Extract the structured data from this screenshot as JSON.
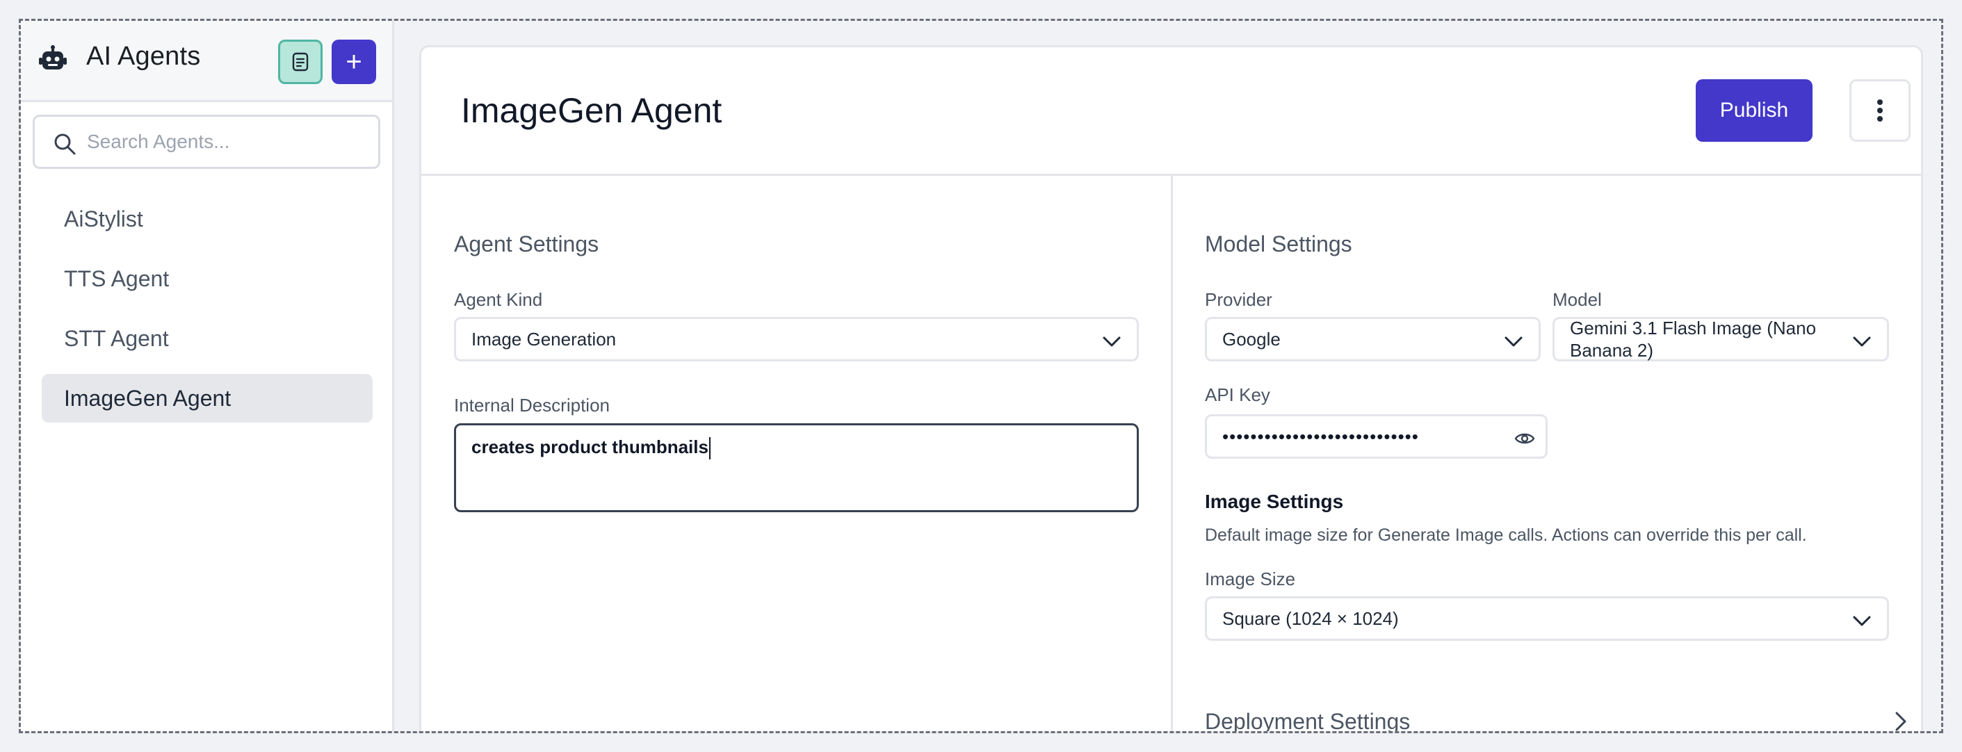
{
  "sidebar": {
    "title": "AI Agents",
    "search_placeholder": "Search Agents...",
    "agents": [
      "AiStylist",
      "TTS Agent",
      "STT Agent",
      "ImageGen Agent"
    ],
    "active_agent": "ImageGen Agent",
    "add_label": "+"
  },
  "header": {
    "title": "ImageGen Agent",
    "publish_label": "Publish"
  },
  "agent_settings": {
    "title": "Agent Settings",
    "kind_label": "Agent Kind",
    "kind_value": "Image Generation",
    "description_label": "Internal Description",
    "description_value": "creates product thumbnails"
  },
  "model_settings": {
    "title": "Model Settings",
    "provider_label": "Provider",
    "provider_value": "Google",
    "model_label": "Model",
    "model_value": "Gemini 3.1 Flash Image (Nano Banana 2)",
    "api_key_label": "API Key",
    "api_key_value": "••••••••••••••••••••••••••••"
  },
  "image_settings": {
    "title": "Image Settings",
    "help": "Default image size for Generate Image calls. Actions can override this per call.",
    "size_label": "Image Size",
    "size_value": "Square (1024 × 1024)"
  },
  "deployment": {
    "title": "Deployment Settings"
  },
  "colors": {
    "accent": "#4338ca",
    "doc_button_bg": "#b7e6da",
    "active_item_bg": "#e5e7eb"
  },
  "icons": [
    "robot-icon",
    "document-icon",
    "plus-icon",
    "search-icon",
    "chevron-down-icon",
    "more-vertical-icon",
    "eye-icon",
    "chevron-right-icon"
  ]
}
